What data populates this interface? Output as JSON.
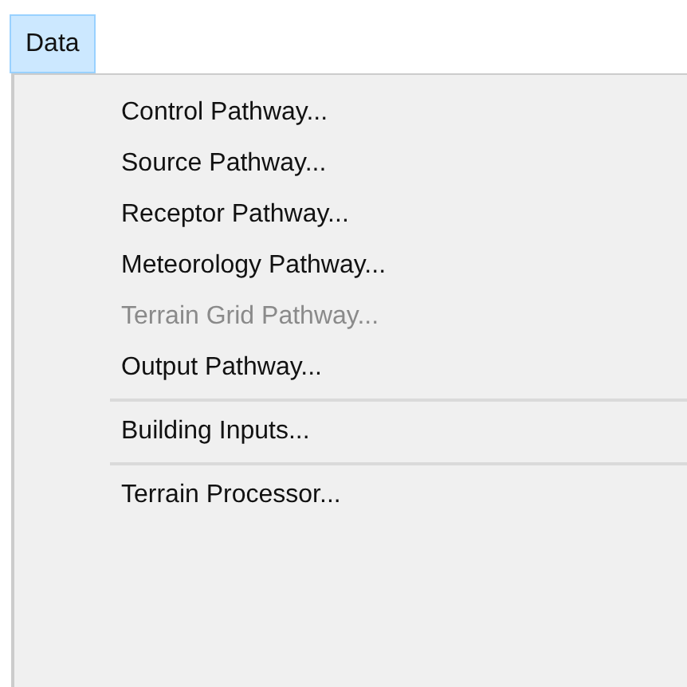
{
  "menu_bar": {
    "label": "Data",
    "selected": true
  },
  "menu": {
    "items": [
      {
        "kind": "item",
        "label": "Control Pathway...",
        "disabled": false
      },
      {
        "kind": "item",
        "label": "Source Pathway...",
        "disabled": false
      },
      {
        "kind": "item",
        "label": "Receptor Pathway...",
        "disabled": false
      },
      {
        "kind": "item",
        "label": "Meteorology Pathway...",
        "disabled": false
      },
      {
        "kind": "item",
        "label": "Terrain Grid Pathway...",
        "disabled": true
      },
      {
        "kind": "item",
        "label": "Output Pathway...",
        "disabled": false
      },
      {
        "kind": "separator"
      },
      {
        "kind": "item",
        "label": "Building Inputs...",
        "disabled": false
      },
      {
        "kind": "separator"
      },
      {
        "kind": "item",
        "label": "Terrain Processor...",
        "disabled": false
      }
    ]
  }
}
